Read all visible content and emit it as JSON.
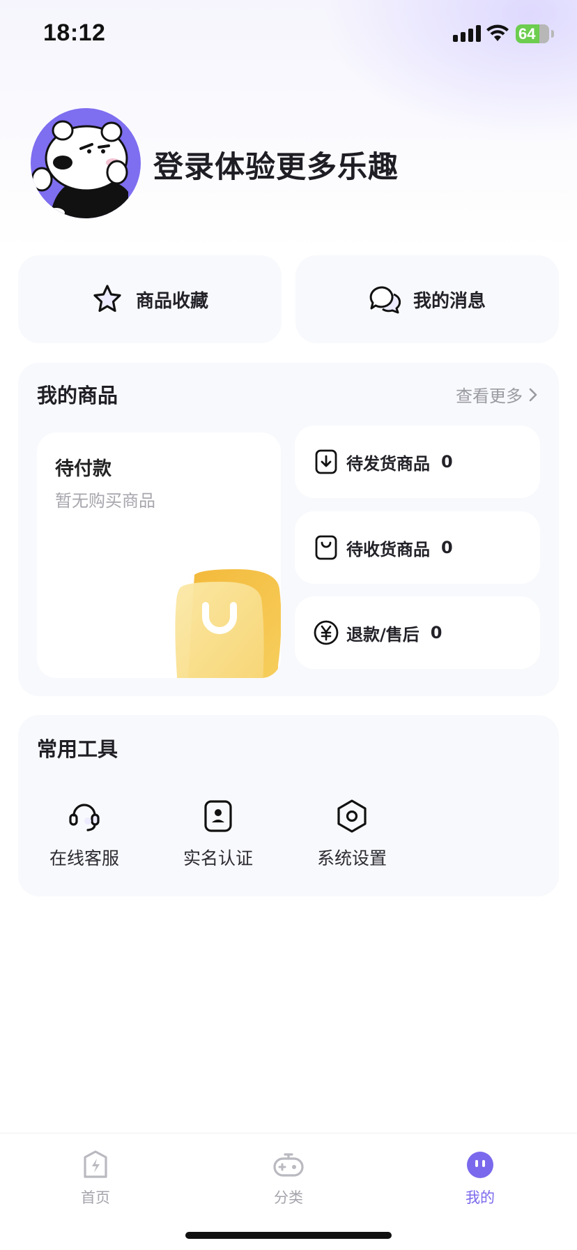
{
  "status_bar": {
    "time": "18:12",
    "battery": "64"
  },
  "profile": {
    "login_prompt": "登录体验更多乐趣"
  },
  "quick_actions": [
    {
      "label": "商品收藏",
      "icon": "star-icon"
    },
    {
      "label": "我的消息",
      "icon": "chat-bubbles-icon"
    }
  ],
  "my_goods": {
    "title": "我的商品",
    "more_label": "查看更多",
    "pending_payment": {
      "title": "待付款",
      "subtitle": "暂无购买商品"
    },
    "statuses": [
      {
        "label": "待发货商品",
        "count": "0",
        "icon": "download-box-icon"
      },
      {
        "label": "待收货商品",
        "count": "0",
        "icon": "bag-icon"
      },
      {
        "label": "退款/售后",
        "count": "0",
        "icon": "yen-icon"
      }
    ]
  },
  "tools": {
    "title": "常用工具",
    "items": [
      {
        "label": "在线客服",
        "icon": "headset-icon"
      },
      {
        "label": "实名认证",
        "icon": "id-card-icon"
      },
      {
        "label": "系统设置",
        "icon": "settings-icon"
      }
    ]
  },
  "tabbar": {
    "items": [
      {
        "label": "首页",
        "icon": "home-bolt-icon",
        "active": false
      },
      {
        "label": "分类",
        "icon": "gamepad-icon",
        "active": false
      },
      {
        "label": "我的",
        "icon": "profile-face-icon",
        "active": true
      }
    ]
  },
  "colors": {
    "accent": "#7a69ec",
    "card_bg": "#f8f9fc",
    "bag_yellow": "#f5c446"
  }
}
